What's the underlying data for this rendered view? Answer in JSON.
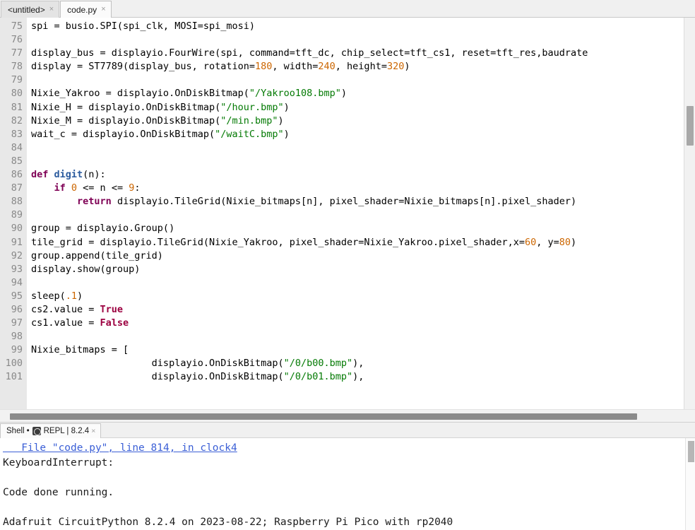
{
  "window": {
    "app": "thonny-ide"
  },
  "editor": {
    "tabs": [
      {
        "label": "<untitled>",
        "close": "×",
        "active": false
      },
      {
        "label": "code.py",
        "close": "×",
        "active": true
      }
    ],
    "first_visible_line": 75,
    "lines": [
      {
        "num": "75",
        "clipped": true,
        "tokens": [
          {
            "t": "spi = busio.SPI(spi_clk, MOSI=spi_mosi)",
            "c": "plain"
          }
        ]
      },
      {
        "num": "76",
        "clipped": false,
        "tokens": [
          {
            "t": "",
            "c": "plain"
          }
        ]
      },
      {
        "num": "77",
        "clipped": false,
        "tokens": [
          {
            "t": "display_bus = displayio.FourWire(spi, command=tft_dc, chip_select=tft_cs1, reset=tft_res,baudrate",
            "c": "plain"
          }
        ]
      },
      {
        "num": "78",
        "clipped": false,
        "tokens": [
          {
            "t": "display = ST7789(display_bus, rotation=",
            "c": "plain"
          },
          {
            "t": "180",
            "c": "num"
          },
          {
            "t": ", width=",
            "c": "plain"
          },
          {
            "t": "240",
            "c": "num"
          },
          {
            "t": ", height=",
            "c": "plain"
          },
          {
            "t": "320",
            "c": "num"
          },
          {
            "t": ")",
            "c": "plain"
          }
        ]
      },
      {
        "num": "79",
        "clipped": false,
        "tokens": [
          {
            "t": "",
            "c": "plain"
          }
        ]
      },
      {
        "num": "80",
        "clipped": false,
        "tokens": [
          {
            "t": "Nixie_Yakroo = displayio.OnDiskBitmap(",
            "c": "plain"
          },
          {
            "t": "\"/Yakroo108.bmp\"",
            "c": "str"
          },
          {
            "t": ")",
            "c": "plain"
          }
        ]
      },
      {
        "num": "81",
        "clipped": false,
        "tokens": [
          {
            "t": "Nixie_H = displayio.OnDiskBitmap(",
            "c": "plain"
          },
          {
            "t": "\"/hour.bmp\"",
            "c": "str"
          },
          {
            "t": ")",
            "c": "plain"
          }
        ]
      },
      {
        "num": "82",
        "clipped": false,
        "tokens": [
          {
            "t": "Nixie_M = displayio.OnDiskBitmap(",
            "c": "plain"
          },
          {
            "t": "\"/min.bmp\"",
            "c": "str"
          },
          {
            "t": ")",
            "c": "plain"
          }
        ]
      },
      {
        "num": "83",
        "clipped": false,
        "tokens": [
          {
            "t": "wait_c = displayio.OnDiskBitmap(",
            "c": "plain"
          },
          {
            "t": "\"/waitC.bmp\"",
            "c": "str"
          },
          {
            "t": ")",
            "c": "plain"
          }
        ]
      },
      {
        "num": "84",
        "clipped": false,
        "tokens": [
          {
            "t": "",
            "c": "plain"
          }
        ]
      },
      {
        "num": "85",
        "clipped": false,
        "tokens": [
          {
            "t": "",
            "c": "plain"
          }
        ]
      },
      {
        "num": "86",
        "clipped": false,
        "tokens": [
          {
            "t": "def ",
            "c": "kw"
          },
          {
            "t": "digit",
            "c": "fname"
          },
          {
            "t": "(n):",
            "c": "plain"
          }
        ]
      },
      {
        "num": "87",
        "clipped": false,
        "tokens": [
          {
            "t": "    ",
            "c": "plain"
          },
          {
            "t": "if ",
            "c": "kw"
          },
          {
            "t": "0",
            "c": "num"
          },
          {
            "t": " <= n <= ",
            "c": "plain"
          },
          {
            "t": "9",
            "c": "num"
          },
          {
            "t": ":",
            "c": "plain"
          }
        ]
      },
      {
        "num": "88",
        "clipped": false,
        "tokens": [
          {
            "t": "        ",
            "c": "plain"
          },
          {
            "t": "return ",
            "c": "kw"
          },
          {
            "t": "displayio.TileGrid(Nixie_bitmaps[n], pixel_shader=Nixie_bitmaps[n].pixel_shader)",
            "c": "plain"
          }
        ]
      },
      {
        "num": "89",
        "clipped": false,
        "tokens": [
          {
            "t": "",
            "c": "plain"
          }
        ]
      },
      {
        "num": "90",
        "clipped": false,
        "tokens": [
          {
            "t": "group = displayio.Group()",
            "c": "plain"
          }
        ]
      },
      {
        "num": "91",
        "clipped": false,
        "tokens": [
          {
            "t": "tile_grid = displayio.TileGrid(Nixie_Yakroo, pixel_shader=Nixie_Yakroo.pixel_shader,x=",
            "c": "plain"
          },
          {
            "t": "60",
            "c": "num"
          },
          {
            "t": ", y=",
            "c": "plain"
          },
          {
            "t": "80",
            "c": "num"
          },
          {
            "t": ")",
            "c": "plain"
          }
        ]
      },
      {
        "num": "92",
        "clipped": false,
        "tokens": [
          {
            "t": "group.append(tile_grid)",
            "c": "plain"
          }
        ]
      },
      {
        "num": "93",
        "clipped": false,
        "tokens": [
          {
            "t": "display.show(group)",
            "c": "plain"
          }
        ]
      },
      {
        "num": "94",
        "clipped": false,
        "tokens": [
          {
            "t": "",
            "c": "plain"
          }
        ]
      },
      {
        "num": "95",
        "clipped": false,
        "tokens": [
          {
            "t": "sleep(",
            "c": "plain"
          },
          {
            "t": ".1",
            "c": "num"
          },
          {
            "t": ")",
            "c": "plain"
          }
        ]
      },
      {
        "num": "96",
        "clipped": false,
        "tokens": [
          {
            "t": "cs2.value = ",
            "c": "plain"
          },
          {
            "t": "True",
            "c": "kw2"
          }
        ]
      },
      {
        "num": "97",
        "clipped": false,
        "tokens": [
          {
            "t": "cs1.value = ",
            "c": "plain"
          },
          {
            "t": "False",
            "c": "kw2"
          }
        ]
      },
      {
        "num": "98",
        "clipped": false,
        "tokens": [
          {
            "t": "",
            "c": "plain"
          }
        ]
      },
      {
        "num": "99",
        "clipped": false,
        "tokens": [
          {
            "t": "Nixie_bitmaps = [",
            "c": "plain"
          }
        ]
      },
      {
        "num": "100",
        "clipped": false,
        "tokens": [
          {
            "t": "                     displayio.OnDiskBitmap(",
            "c": "plain"
          },
          {
            "t": "\"/0/b00.bmp\"",
            "c": "str"
          },
          {
            "t": "),",
            "c": "plain"
          }
        ]
      },
      {
        "num": "101",
        "clipped": false,
        "tokens": [
          {
            "t": "                     displayio.OnDiskBitmap(",
            "c": "plain"
          },
          {
            "t": "\"/0/b01.bmp\"",
            "c": "str"
          },
          {
            "t": "),",
            "c": "plain"
          }
        ]
      }
    ]
  },
  "shell": {
    "tab": {
      "label_prefix": "Shell",
      "separator": "•",
      "icon": "repl-icon",
      "label_suffix": "REPL | 8.2.4",
      "close": "×"
    },
    "output": [
      {
        "text": "   File \"code.py\", line 814, in clock4",
        "style": "errlink"
      },
      {
        "text": "KeyboardInterrupt:",
        "style": "normal"
      },
      {
        "text": "",
        "style": "normal"
      },
      {
        "text": "Code done running.",
        "style": "normal"
      },
      {
        "text": "",
        "style": "normal"
      },
      {
        "text": "Adafruit CircuitPython 8.2.4 on 2023-08-22; Raspberry Pi Pico with rp2040",
        "style": "normal"
      }
    ]
  },
  "colors": {
    "string": "#047a04",
    "number": "#cc6600",
    "keyword": "#7f0055",
    "builtin_const": "#9c0040",
    "function_name": "#2b5b9e",
    "link": "#3b5fd6",
    "gutter_bg": "#e8e8e8"
  }
}
